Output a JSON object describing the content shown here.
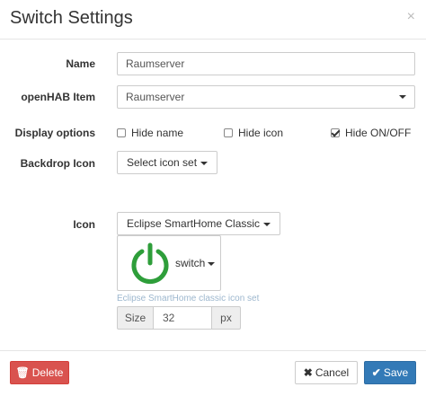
{
  "modal": {
    "title": "Switch Settings",
    "close_glyph": "×"
  },
  "form": {
    "name": {
      "label": "Name",
      "value": "Raumserver"
    },
    "item": {
      "label": "openHAB Item",
      "value": "Raumserver"
    },
    "display": {
      "label": "Display options",
      "options": [
        {
          "label": "Hide name",
          "checked": false
        },
        {
          "label": "Hide icon",
          "checked": false
        },
        {
          "label": "Hide ON/OFF",
          "checked": true
        }
      ]
    },
    "backdrop": {
      "label": "Backdrop Icon",
      "button": "Select icon set"
    },
    "icon": {
      "label": "Icon",
      "set_button": "Eclipse SmartHome Classic",
      "preview_name": "switch",
      "hint": "Eclipse SmartHome classic icon set",
      "icon": "power-icon",
      "icon_color": "#2e9e3a"
    },
    "size": {
      "prefix": "Size",
      "value": "32",
      "suffix": "px"
    }
  },
  "footer": {
    "delete_glyph": "🗑",
    "delete_label": "Delete",
    "cancel_glyph": "✖",
    "cancel_label": "Cancel",
    "save_glyph": "✔",
    "save_label": "Save"
  },
  "colors": {
    "danger": "#d9534f",
    "primary": "#337ab7",
    "hint": "#9db7ce"
  }
}
